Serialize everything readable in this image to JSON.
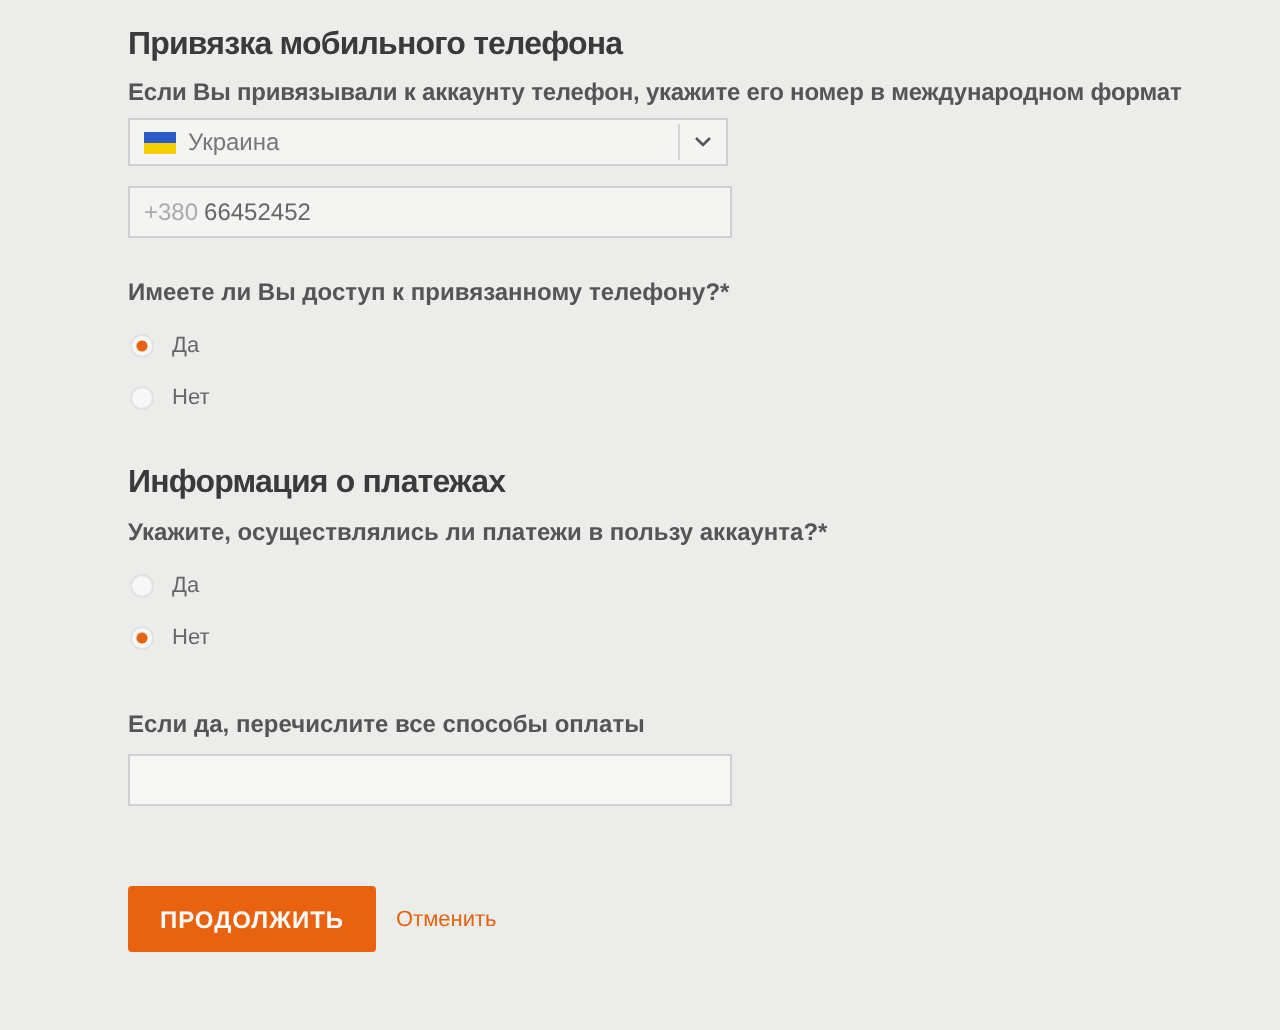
{
  "phone_section": {
    "title": "Привязка мобильного телефона",
    "hint": "Если Вы привязывали к аккаунту телефон, укажите его номер в международном формат",
    "country_select": {
      "value": "Украина"
    },
    "phone_field": {
      "prefix": "+380",
      "value": "66452452"
    },
    "access_question": {
      "label": "Имеете ли Вы доступ к привязанному телефону?*",
      "options": [
        {
          "label": "Да",
          "selected": true
        },
        {
          "label": "Нет",
          "selected": false
        }
      ]
    }
  },
  "payment_section": {
    "title": "Информация о платежах",
    "payments_question": {
      "label": "Укажите, осуществлялись ли платежи в пользу аккаунта?*",
      "options": [
        {
          "label": "Да",
          "selected": false
        },
        {
          "label": "Нет",
          "selected": true
        }
      ]
    },
    "methods_field": {
      "label": "Если да, перечислите все способы оплаты"
    }
  },
  "buttons": {
    "continue": "ПРОДОЛЖИТЬ",
    "cancel": "Отменить"
  }
}
